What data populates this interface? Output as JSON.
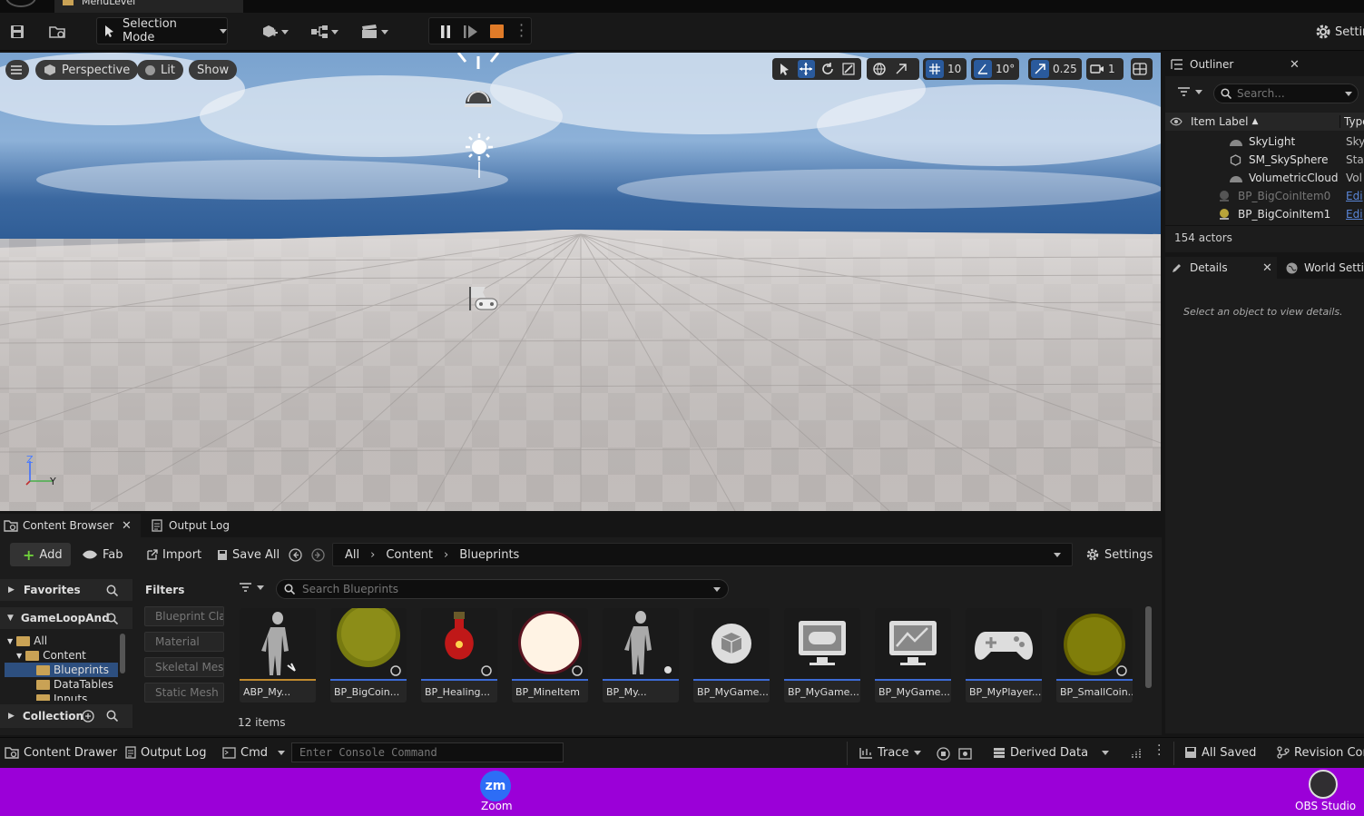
{
  "window": {
    "level_tab": "MenuLevel"
  },
  "toolbar": {
    "selection_mode": "Selection Mode",
    "settings_label": "Settings"
  },
  "viewport": {
    "perspective": "Perspective",
    "lit": "Lit",
    "show": "Show",
    "grid_snap": "10",
    "rot_snap": "10°",
    "scale_snap": "0.25",
    "camera_speed": "1",
    "axis_z": "Z",
    "axis_y": "Y"
  },
  "outliner": {
    "title": "Outliner",
    "search_placeholder": "Search...",
    "col_label": "Item Label",
    "col_type": "Type",
    "items": [
      {
        "label": "SkyLight",
        "type": "Sky"
      },
      {
        "label": "SM_SkySphere",
        "type": "Stat"
      },
      {
        "label": "VolumetricCloud",
        "type": "Vol"
      },
      {
        "label": "BP_BigCoinItem0",
        "type": "Edi"
      },
      {
        "label": "BP_BigCoinItem1",
        "type": "Edi"
      }
    ],
    "count": "154 actors"
  },
  "details": {
    "tab_details": "Details",
    "tab_world": "World Setti",
    "empty_msg": "Select an object to view details."
  },
  "content_browser": {
    "tab_cb": "Content Browser",
    "tab_output": "Output Log",
    "add": "Add",
    "fab": "Fab",
    "import": "Import",
    "save_all": "Save All",
    "path": [
      "All",
      "Content",
      "Blueprints"
    ],
    "settings": "Settings",
    "favorites": "Favorites",
    "project": "GameLoopAnd",
    "collection": "Collection",
    "tree": [
      "All",
      "Content",
      "Blueprints",
      "DataTables",
      "Inputs"
    ],
    "filters_title": "Filters",
    "filters": [
      "Blueprint Cla",
      "Material",
      "Skeletal Mes",
      "Static Mesh"
    ],
    "search_placeholder": "Search Blueprints",
    "assets": [
      "ABP_My...",
      "BP_BigCoin...",
      "BP_Healing...",
      "BP_MineItem",
      "BP_My...",
      "BP_MyGame...",
      "BP_MyGame...",
      "BP_MyGame...",
      "BP_MyPlayer...",
      "BP_SmallCoin..."
    ],
    "item_count": "12 items"
  },
  "statusbar": {
    "content_drawer": "Content Drawer",
    "output_log": "Output Log",
    "cmd": "Cmd",
    "console_placeholder": "Enter Console Command",
    "trace": "Trace",
    "derived_data": "Derived Data",
    "all_saved": "All Saved",
    "revision": "Revision Con"
  },
  "taskbar": {
    "zoom": "Zoom",
    "zoom_icon": "zm",
    "obs": "OBS Studio"
  },
  "colors": {
    "accent": "#2a5a9c",
    "taskbar": "#9b00d8",
    "stop": "#e07b28"
  }
}
